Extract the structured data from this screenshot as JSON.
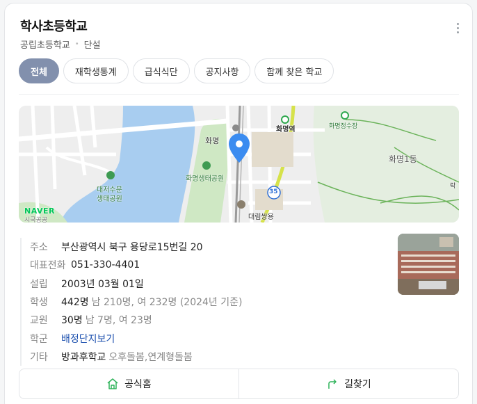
{
  "school": {
    "name": "학사초등학교",
    "type": "공립초등학교",
    "gender": "단설"
  },
  "menu": {
    "icon": "more-vertical-icon"
  },
  "tabs": [
    {
      "label": "전체",
      "active": true
    },
    {
      "label": "재학생통계",
      "active": false
    },
    {
      "label": "급식식단",
      "active": false
    },
    {
      "label": "공지사항",
      "active": false
    },
    {
      "label": "함께 찾은 학교",
      "active": false
    }
  ],
  "map": {
    "labels": {
      "station": "화명역",
      "station_left": "화명",
      "water_plant": "화명정수장",
      "district": "화명1동",
      "park": "화명생태공원",
      "daejeo_1": "대저수문",
      "daejeo_2": "생태공원",
      "route": "35",
      "store": "대림쌍용",
      "small": "락",
      "bottom_left": "시국공공"
    },
    "brand": "NAVER",
    "colors": {
      "river": "#a8cdf0",
      "park": "#cfe8c4",
      "road": "#ffffff",
      "rail": "#9a9a9a",
      "pin": "#3b8cf0",
      "route": "#d6e24a"
    }
  },
  "info": {
    "address": {
      "label": "주소",
      "value": "부산광역시 북구 용당로15번길 20"
    },
    "phone": {
      "label": "대표전화",
      "value": "051-330-4401"
    },
    "founded": {
      "label": "설립",
      "value": "2003년 03월 01일"
    },
    "students": {
      "label": "학생",
      "value": "442명",
      "extra": "남 210명, 여 232명 (2024년 기준)"
    },
    "teachers": {
      "label": "교원",
      "value": "30명",
      "extra": "남 7명, 여 23명"
    },
    "district": {
      "label": "학군",
      "link": "배정단지보기"
    },
    "etc": {
      "label": "기타",
      "value": "방과후학교",
      "extra": "오후돌봄,연계형돌봄"
    }
  },
  "actions": {
    "homepage": {
      "label": "공식홈",
      "icon": "home-icon"
    },
    "directions": {
      "label": "길찾기",
      "icon": "directions-icon"
    }
  }
}
